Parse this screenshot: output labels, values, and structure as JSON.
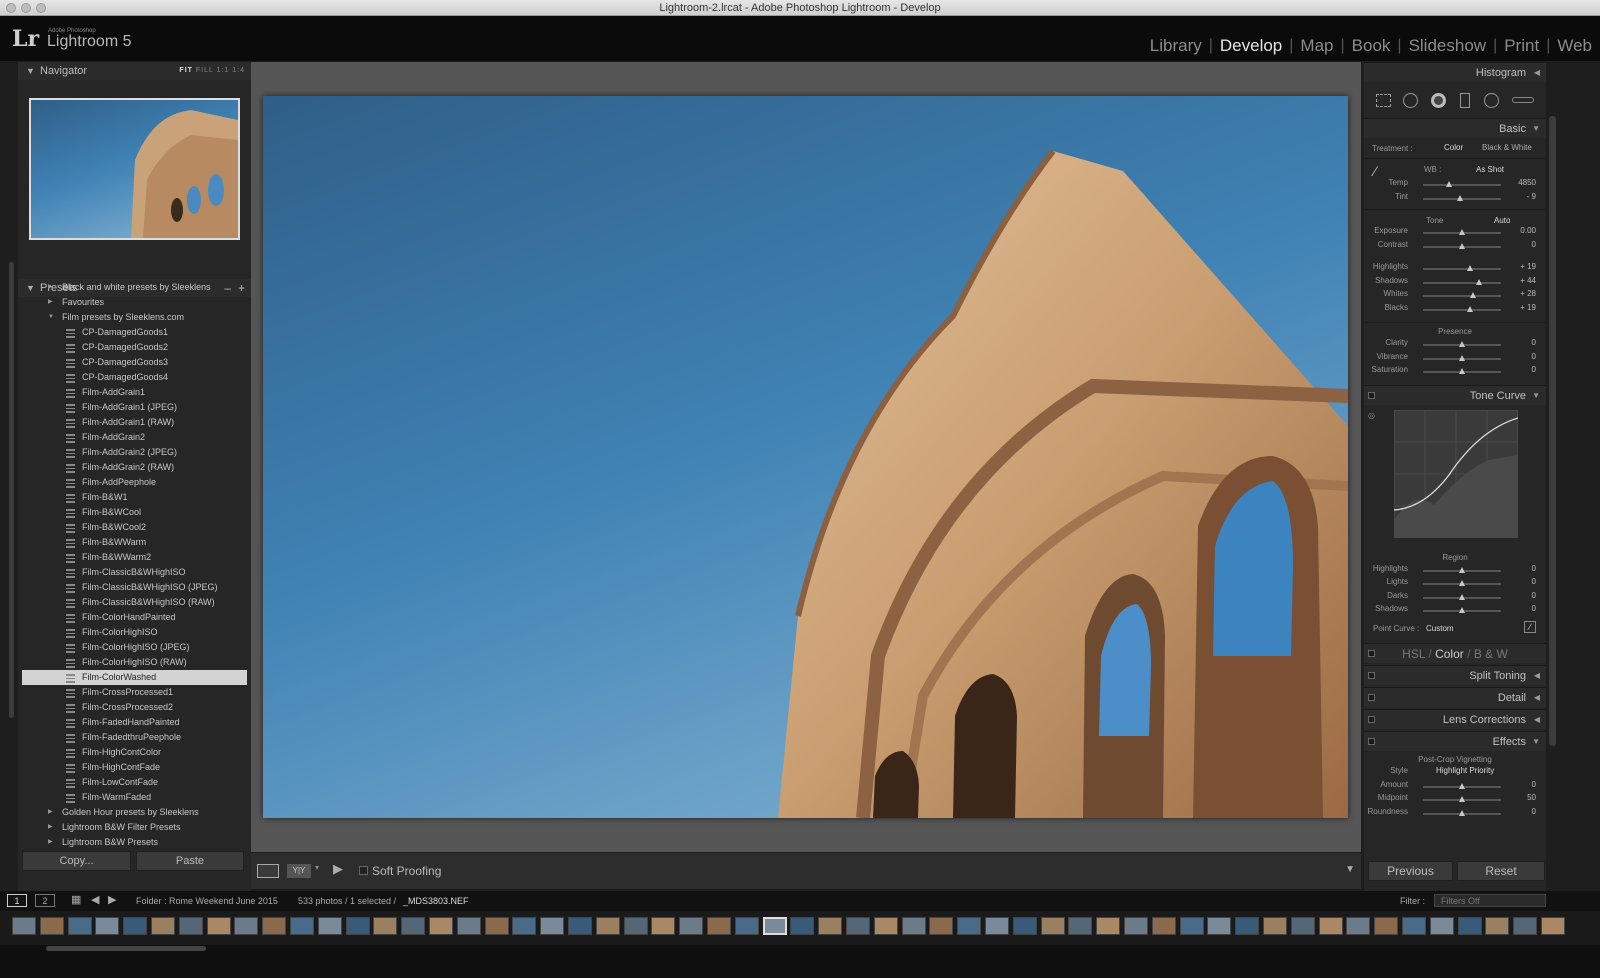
{
  "window": {
    "title": "Lightroom-2.lrcat - Adobe Photoshop Lightroom - Develop"
  },
  "logo": {
    "mark": "Lr",
    "sub": "Adobe Photoshop",
    "name": "Lightroom 5"
  },
  "modules": [
    "Library",
    "Develop",
    "Map",
    "Book",
    "Slideshow",
    "Print",
    "Web"
  ],
  "active_module": "Develop",
  "navigator": {
    "title": "Navigator",
    "opts": [
      "FIT",
      "FILL",
      "1:1",
      "1:4"
    ]
  },
  "presets": {
    "title": "Presets",
    "items": [
      {
        "kind": "folder",
        "label": "Black and white presets by Sleeklens"
      },
      {
        "kind": "folder",
        "label": "Favourites"
      },
      {
        "kind": "folder-open",
        "label": "Film presets by Sleeklens.com"
      },
      {
        "kind": "preset",
        "label": "CP-DamagedGoods1"
      },
      {
        "kind": "preset",
        "label": "CP-DamagedGoods2"
      },
      {
        "kind": "preset",
        "label": "CP-DamagedGoods3"
      },
      {
        "kind": "preset",
        "label": "CP-DamagedGoods4"
      },
      {
        "kind": "preset",
        "label": "Film-AddGrain1"
      },
      {
        "kind": "preset",
        "label": "Film-AddGrain1 (JPEG)"
      },
      {
        "kind": "preset",
        "label": "Film-AddGrain1 (RAW)"
      },
      {
        "kind": "preset",
        "label": "Film-AddGrain2"
      },
      {
        "kind": "preset",
        "label": "Film-AddGrain2 (JPEG)"
      },
      {
        "kind": "preset",
        "label": "Film-AddGrain2 (RAW)"
      },
      {
        "kind": "preset",
        "label": "Film-AddPeephole"
      },
      {
        "kind": "preset",
        "label": "Film-B&W1"
      },
      {
        "kind": "preset",
        "label": "Film-B&WCool"
      },
      {
        "kind": "preset",
        "label": "Film-B&WCool2"
      },
      {
        "kind": "preset",
        "label": "Film-B&WWarm"
      },
      {
        "kind": "preset",
        "label": "Film-B&WWarm2"
      },
      {
        "kind": "preset",
        "label": "Film-ClassicB&WHighISO"
      },
      {
        "kind": "preset",
        "label": "Film-ClassicB&WHighISO (JPEG)"
      },
      {
        "kind": "preset",
        "label": "Film-ClassicB&WHighISO (RAW)"
      },
      {
        "kind": "preset",
        "label": "Film-ColorHandPainted"
      },
      {
        "kind": "preset",
        "label": "Film-ColorHighISO"
      },
      {
        "kind": "preset",
        "label": "Film-ColorHighISO (JPEG)"
      },
      {
        "kind": "preset",
        "label": "Film-ColorHighISO (RAW)"
      },
      {
        "kind": "preset-sel",
        "label": "Film-ColorWashed"
      },
      {
        "kind": "preset",
        "label": "Film-CrossProcessed1"
      },
      {
        "kind": "preset",
        "label": "Film-CrossProcessed2"
      },
      {
        "kind": "preset",
        "label": "Film-FadedHandPainted"
      },
      {
        "kind": "preset",
        "label": "Film-FadedthruPeephole"
      },
      {
        "kind": "preset",
        "label": "Film-HighContColor"
      },
      {
        "kind": "preset",
        "label": "Film-HighContFade"
      },
      {
        "kind": "preset",
        "label": "Film-LowContFade"
      },
      {
        "kind": "preset",
        "label": "Film-WarmFaded"
      },
      {
        "kind": "folder",
        "label": "Golden Hour presets by Sleeklens"
      },
      {
        "kind": "folder",
        "label": "Lightroom B&W Filter Presets"
      },
      {
        "kind": "folder",
        "label": "Lightroom B&W Presets"
      }
    ],
    "copy": "Copy...",
    "paste": "Paste"
  },
  "toolbar": {
    "soft_proofing": "Soft Proofing",
    "compare": "Y|Y"
  },
  "right": {
    "histogram": "Histogram",
    "basic": "Basic",
    "treatment_label": "Treatment :",
    "treatment_color": "Color",
    "treatment_bw": "Black & White",
    "wb_label": "WB :",
    "wb_value": "As Shot",
    "wb_sliders": [
      {
        "label": "Temp",
        "value": "4850",
        "pos": 0.33
      },
      {
        "label": "Tint",
        "value": "- 9",
        "pos": 0.47
      }
    ],
    "tone_label": "Tone",
    "auto": "Auto",
    "tone_sliders": [
      {
        "label": "Exposure",
        "value": "0.00",
        "pos": 0.5
      },
      {
        "label": "Contrast",
        "value": "0",
        "pos": 0.5
      }
    ],
    "tone_sliders2": [
      {
        "label": "Highlights",
        "value": "+ 19",
        "pos": 0.6
      },
      {
        "label": "Shadows",
        "value": "+ 44",
        "pos": 0.72
      },
      {
        "label": "Whites",
        "value": "+ 28",
        "pos": 0.64
      },
      {
        "label": "Blacks",
        "value": "+ 19",
        "pos": 0.6
      }
    ],
    "presence_label": "Presence",
    "presence_sliders": [
      {
        "label": "Clarity",
        "value": "0",
        "pos": 0.5
      },
      {
        "label": "Vibrance",
        "value": "0",
        "pos": 0.5
      },
      {
        "label": "Saturation",
        "value": "0",
        "pos": 0.5
      }
    ],
    "tone_curve": "Tone Curve",
    "region_label": "Region",
    "region_sliders": [
      {
        "label": "Highlights",
        "value": "0",
        "pos": 0.5
      },
      {
        "label": "Lights",
        "value": "0",
        "pos": 0.5
      },
      {
        "label": "Darks",
        "value": "0",
        "pos": 0.5
      },
      {
        "label": "Shadows",
        "value": "0",
        "pos": 0.5
      }
    ],
    "point_curve_label": "Point Curve :",
    "point_curve_value": "Custom",
    "hsl": "HSL",
    "color": "Color",
    "bw": "B & W",
    "split_toning": "Split Toning",
    "detail": "Detail",
    "lens": "Lens Corrections",
    "effects": "Effects",
    "vignette_label": "Post-Crop Vignetting",
    "style_label": "Style",
    "style_value": "Highlight Priority",
    "vignette_sliders": [
      {
        "label": "Amount",
        "value": "0",
        "pos": 0.5
      },
      {
        "label": "Midpoint",
        "value": "50",
        "pos": 0.5
      },
      {
        "label": "Roundness",
        "value": "0",
        "pos": 0.5
      }
    ],
    "previous": "Previous",
    "reset": "Reset"
  },
  "filmbar": {
    "screen1": "1",
    "screen2": "2",
    "folder": "Folder : Rome Weekend June 2015",
    "count": "533 photos / 1 selected /",
    "file": "_MDS3803.NEF",
    "filter_label": "Filter :",
    "filter_value": "Filters Off"
  },
  "colors": {
    "accent": "#d3d3d3",
    "panel": "#262626",
    "sky": "#3f82b4"
  }
}
